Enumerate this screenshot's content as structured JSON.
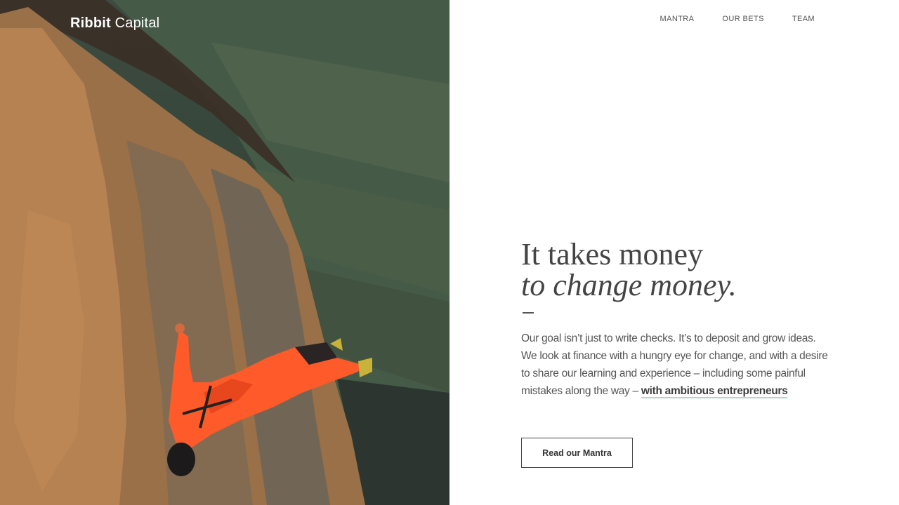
{
  "brand": {
    "logo_bold": "Ribbit",
    "logo_regular": "Capital"
  },
  "nav": {
    "items": [
      "MANTRA",
      "OUR BETS",
      "TEAM"
    ]
  },
  "hero": {
    "headline_line1": "It takes money",
    "headline_line2": "to change money.",
    "body": "Our goal isn’t just to write checks. It’s to deposit and grow ideas. We look at finance with a hungry eye for change, and with a desire to share our learning and experience – including some painful mistakes along the way – ",
    "body_link": "with ambitious entrepreneurs",
    "cta_label": "Read our Mantra"
  },
  "colors": {
    "accent_underline": "#a8dcc6",
    "text": "#444444",
    "jumpsuit": "#ff5a2a"
  }
}
